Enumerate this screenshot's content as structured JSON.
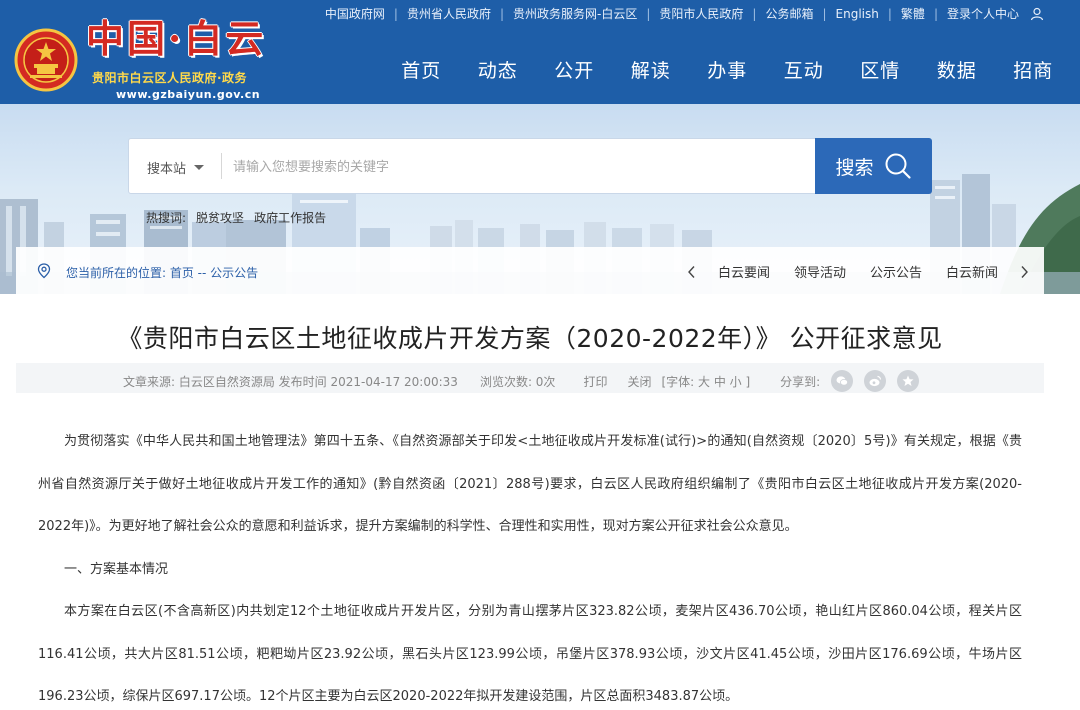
{
  "header": {
    "brand_title": "中国·白云",
    "brand_subtitle": "贵阳市白云区人民政府·政务",
    "brand_url": "www.gzbaiyun.gov.cn",
    "top_links": [
      "中国政府网",
      "贵州省人民政府",
      "贵州政务服务网-白云区",
      "贵阳市人民政府",
      "公务邮箱",
      "English",
      "繁體",
      "登录个人中心"
    ],
    "nav": [
      "首页",
      "动态",
      "公开",
      "解读",
      "办事",
      "互动",
      "区情",
      "数据",
      "招商"
    ],
    "colors": {
      "header_bg": "#1e5ea8",
      "brand_red": "#d42a22",
      "subtitle_gold": "#ffd94a"
    }
  },
  "search": {
    "scope": "搜本站",
    "placeholder": "请输入您想要搜索的关键字",
    "button_label": "搜索",
    "hot_label": "热搜词:",
    "hot_words": [
      "脱贫攻坚",
      "政府工作报告"
    ]
  },
  "breadcrumb": {
    "text": "您当前所在的位置: 首页 -- 公示公告",
    "categories": [
      "白云要闻",
      "领导活动",
      "公示公告",
      "白云新闻"
    ]
  },
  "article": {
    "title": "《贵阳市白云区土地征收成片开发方案（2020-2022年）》 公开征求意见",
    "meta": {
      "source": "文章来源: 白云区自然资源局 发布时间 2021-04-17 20:00:33",
      "views": "浏览次数: 0次",
      "print": "打印",
      "close": "关闭",
      "font_size": "[字体: 大 中 小 ]",
      "share": "分享到:"
    },
    "paragraphs": [
      "为贯彻落实《中华人民共和国土地管理法》第四十五条、《自然资源部关于印发<土地征收成片开发标准(试行)>的通知(自然资规〔2020〕5号)》有关规定，根据《贵州省自然资源厅关于做好土地征收成片开发工作的通知》(黔自然资函〔2021〕288号)要求，白云区人民政府组织编制了《贵阳市白云区土地征收成片开发方案(2020-2022年)》。为更好地了解社会公众的意愿和利益诉求，提升方案编制的科学性、合理性和实用性，现对方案公开征求社会公众意见。",
      "一、方案基本情况",
      "本方案在白云区(不含高新区)内共划定12个土地征收成片开发片区，分别为青山摆茅片区323.82公顷，麦架片区436.70公顷，艳山红片区860.04公顷，程关片区116.41公顷，共大片区81.51公顷，粑粑坳片区23.92公顷，黑石头片区123.99公顷，吊堡片区378.93公顷，沙文片区41.45公顷，沙田片区176.69公顷，牛场片区196.23公顷，综保片区697.17公顷。12个片区主要为白云区2020-2022年拟开发建设范围，片区总面积3483.87公顷。"
    ]
  }
}
